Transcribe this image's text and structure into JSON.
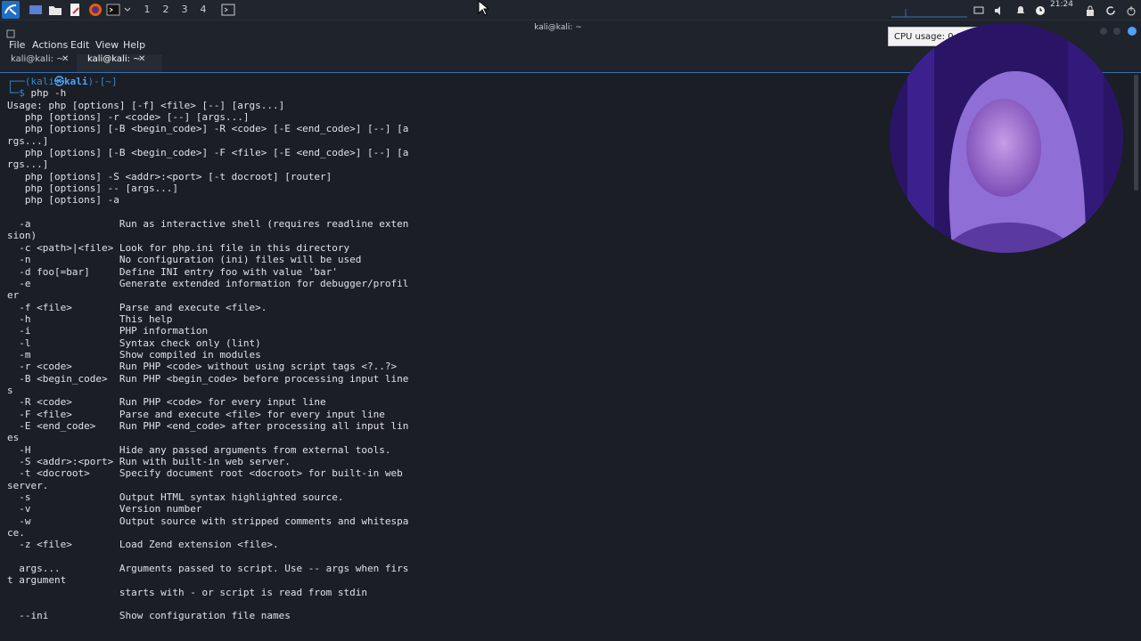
{
  "panel": {
    "workspaces": [
      "1",
      "2",
      "3",
      "4"
    ],
    "clock": "21:24",
    "icons": [
      "kali-menu-icon",
      "desktop-icon",
      "file-manager-icon",
      "text-editor-icon",
      "firefox-icon",
      "terminal-icon"
    ]
  },
  "window": {
    "title": "kali@kali: ~",
    "menu": [
      "File",
      "Actions",
      "Edit",
      "View",
      "Help"
    ],
    "tabs": [
      {
        "label": "kali@kali: ~",
        "active": false
      },
      {
        "label": "kali@kali: ~",
        "active": true
      }
    ]
  },
  "tooltip": {
    "cpu_usage": "CPU usage: 0.0"
  },
  "terminal": {
    "prompt_user": "(kali",
    "prompt_at": "㉿",
    "prompt_host": "kali",
    "prompt_dir": ")-[~]",
    "command": "php -h",
    "lines": [
      "Usage: php [options] [-f] <file> [--] [args...]",
      "   php [options] -r <code> [--] [args...]",
      "   php [options] [-B <begin_code>] -R <code> [-E <end_code>] [--] [a",
      "rgs...]",
      "   php [options] [-B <begin_code>] -F <file> [-E <end_code>] [--] [a",
      "rgs...]",
      "   php [options] -S <addr>:<port> [-t docroot] [router]",
      "   php [options] -- [args...]",
      "   php [options] -a",
      "",
      "  -a               Run as interactive shell (requires readline exten",
      "sion)",
      "  -c <path>|<file> Look for php.ini file in this directory",
      "  -n               No configuration (ini) files will be used",
      "  -d foo[=bar]     Define INI entry foo with value 'bar'",
      "  -e               Generate extended information for debugger/profil",
      "er",
      "  -f <file>        Parse and execute <file>.",
      "  -h               This help",
      "  -i               PHP information",
      "  -l               Syntax check only (lint)",
      "  -m               Show compiled in modules",
      "  -r <code>        Run PHP <code> without using script tags <?..?>",
      "  -B <begin_code>  Run PHP <begin_code> before processing input line",
      "s",
      "  -R <code>        Run PHP <code> for every input line",
      "  -F <file>        Parse and execute <file> for every input line",
      "  -E <end_code>    Run PHP <end_code> after processing all input lin",
      "es",
      "  -H               Hide any passed arguments from external tools.",
      "  -S <addr>:<port> Run with built-in web server.",
      "  -t <docroot>     Specify document root <docroot> for built-in web",
      "server.",
      "  -s               Output HTML syntax highlighted source.",
      "  -v               Version number",
      "  -w               Output source with stripped comments and whitespa",
      "ce.",
      "  -z <file>        Load Zend extension <file>.",
      "",
      "  args...          Arguments passed to script. Use -- args when firs",
      "t argument",
      "                   starts with - or script is read from stdin",
      "",
      "  --ini            Show configuration file names"
    ]
  },
  "colors": {
    "terminal_bg": "#1b1e24",
    "prompt": "#2d8ad8",
    "accent": "#3a6fb4"
  }
}
